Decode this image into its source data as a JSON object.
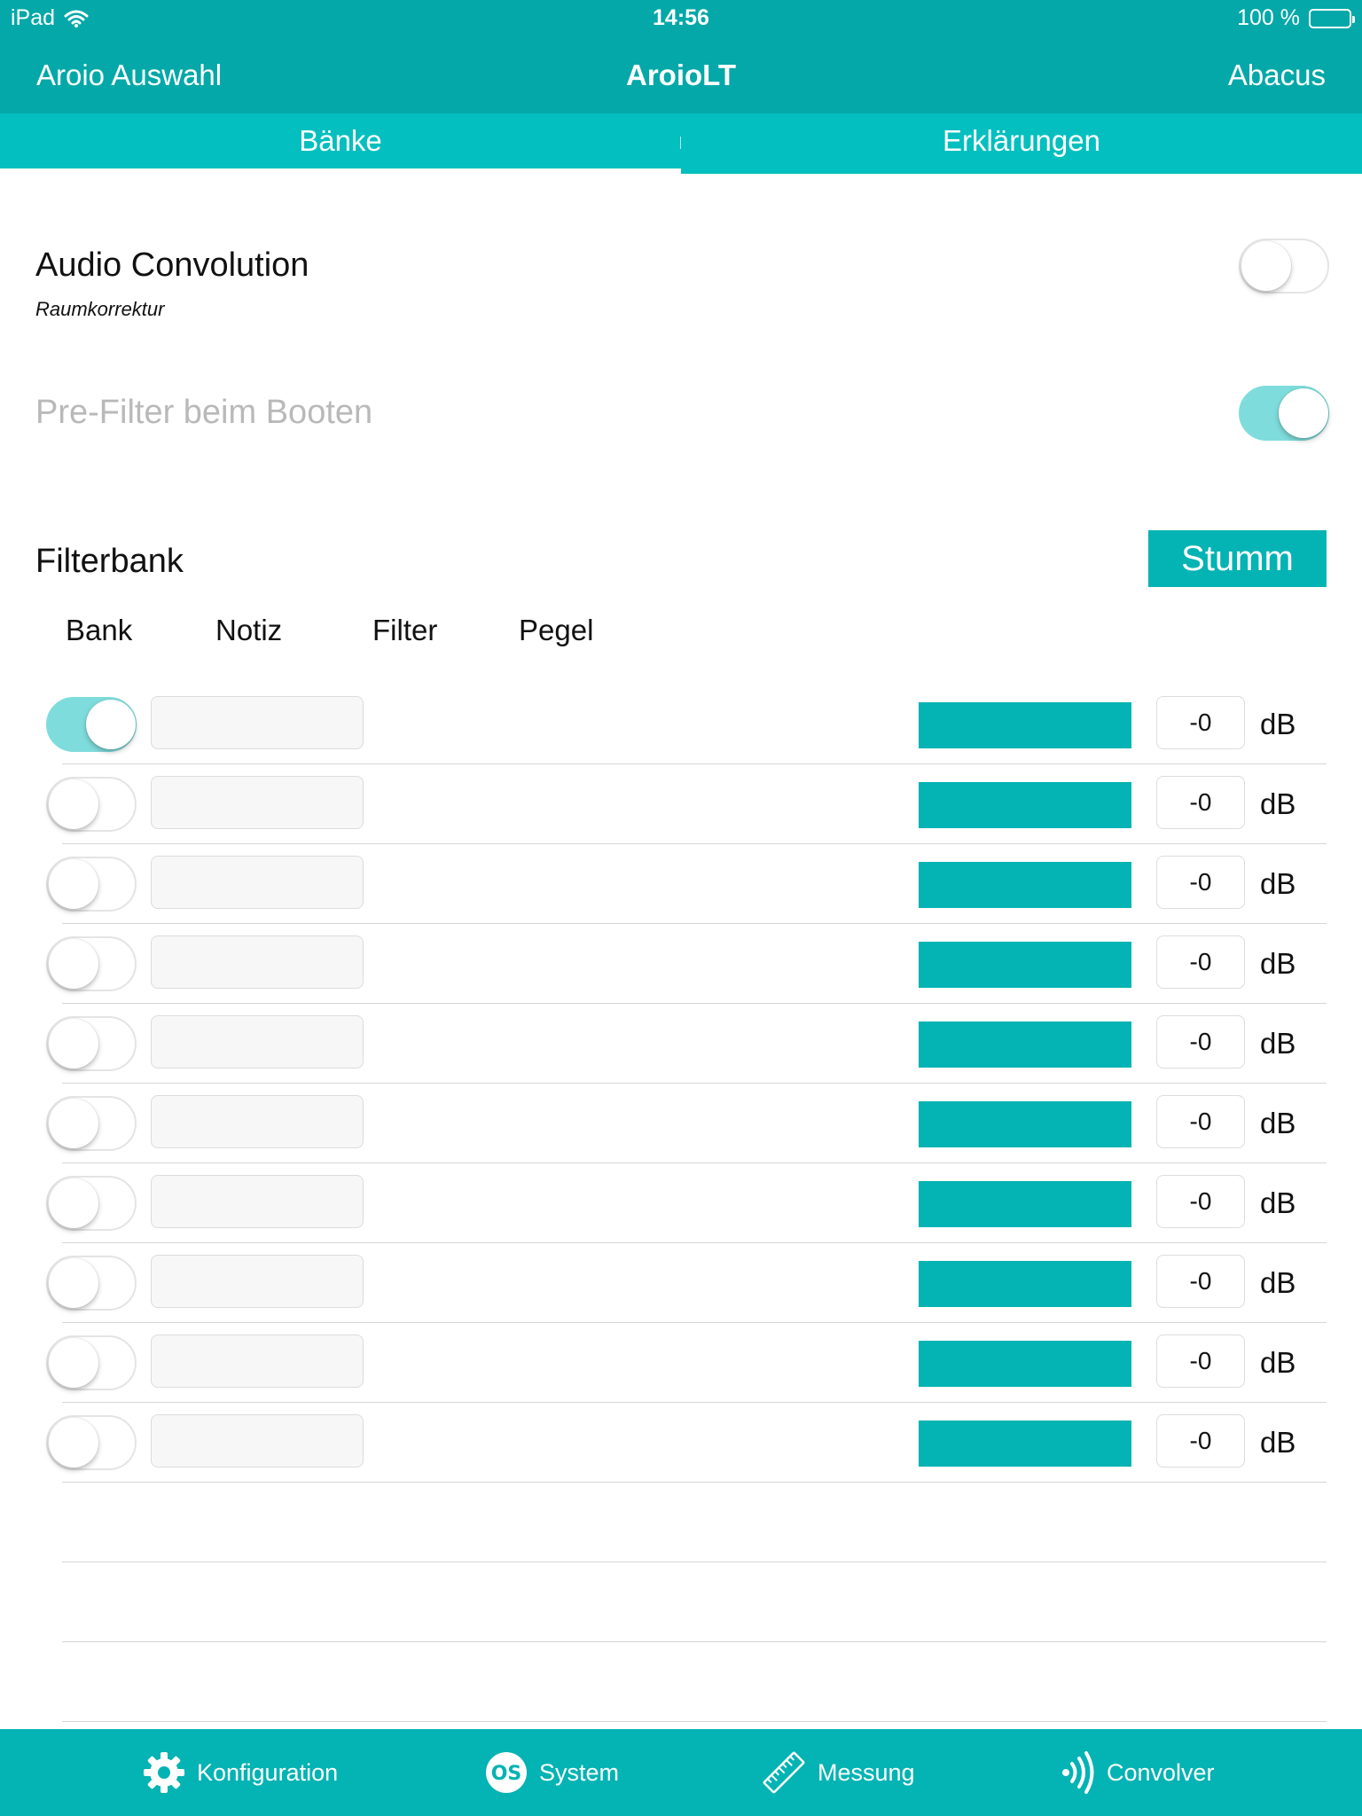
{
  "status_bar": {
    "device": "iPad",
    "time": "14:56",
    "battery_text": "100 %",
    "icons": [
      "wifi-icon",
      "battery-icon"
    ]
  },
  "nav": {
    "back_label": "Aroio Auswahl",
    "title": "AroioLT",
    "right_label": "Abacus"
  },
  "tabs": [
    {
      "label": "Bänke",
      "active": true
    },
    {
      "label": "Erklärungen",
      "active": false
    }
  ],
  "settings": {
    "audio_convolution": {
      "label": "Audio Convolution",
      "sublabel": "Raumkorrektur",
      "on": false
    },
    "prefilter": {
      "label": "Pre-Filter beim Booten",
      "on": true,
      "disabled": true
    }
  },
  "filterbank": {
    "title": "Filterbank",
    "mute_label": "Stumm",
    "columns": [
      "Bank",
      "Notiz",
      "Filter",
      "Pegel"
    ],
    "rows": [
      {
        "on": true,
        "note": "",
        "level": "-0",
        "unit": "dB"
      },
      {
        "on": false,
        "note": "",
        "level": "-0",
        "unit": "dB"
      },
      {
        "on": false,
        "note": "",
        "level": "-0",
        "unit": "dB"
      },
      {
        "on": false,
        "note": "",
        "level": "-0",
        "unit": "dB"
      },
      {
        "on": false,
        "note": "",
        "level": "-0",
        "unit": "dB"
      },
      {
        "on": false,
        "note": "",
        "level": "-0",
        "unit": "dB"
      },
      {
        "on": false,
        "note": "",
        "level": "-0",
        "unit": "dB"
      },
      {
        "on": false,
        "note": "",
        "level": "-0",
        "unit": "dB"
      },
      {
        "on": false,
        "note": "",
        "level": "-0",
        "unit": "dB"
      },
      {
        "on": false,
        "note": "",
        "level": "-0",
        "unit": "dB"
      }
    ]
  },
  "bottom_tabs": [
    {
      "label": "Konfiguration",
      "icon": "gear-icon"
    },
    {
      "label": "System",
      "icon": "os-icon"
    },
    {
      "label": "Messung",
      "icon": "ruler-icon"
    },
    {
      "label": "Convolver",
      "icon": "wave-icon"
    }
  ],
  "colors": {
    "accent": "#04b3b3",
    "header": "#04a8a8",
    "switch_on": "#7fdcdc"
  }
}
